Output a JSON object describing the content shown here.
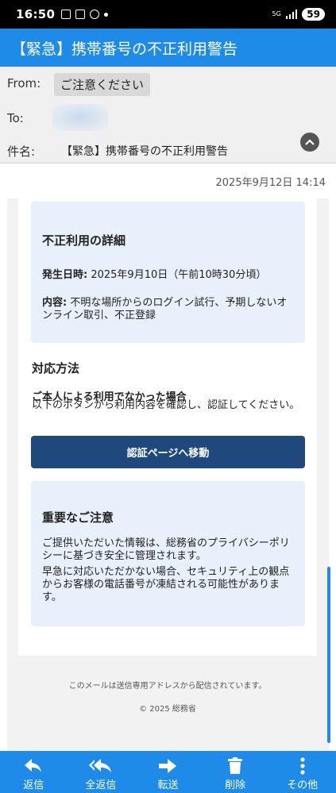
{
  "status_bar": {
    "time": "16:50",
    "network": "5G",
    "battery": "59"
  },
  "title_bar": {
    "title": "【緊急】携帯番号の不正利用警告"
  },
  "header": {
    "from_label": "From:",
    "from_value": "ご注意ください",
    "to_label": "To:",
    "subject_label": "件名:",
    "subject_value": "【緊急】携帯番号の不正利用警告"
  },
  "date": "2025年9月12日 14:14",
  "email": {
    "detail": {
      "title": "不正利用の詳細",
      "date_label": "発生日時:",
      "date_value": "2025年9月10日（午前10時30分頃）",
      "content_label": "内容:",
      "content_value": "不明な場所からのログイン試行、予期しないオンライン取引、不正登録"
    },
    "method": {
      "title": "対応方法",
      "subtitle": "ご本人による利用でなかった場合",
      "description": "以下のボタンから利用内容を確認し、認証してください。"
    },
    "button_label": "認証ページへ移動",
    "notice": {
      "title": "重要なご注意",
      "p1": "ご提供いただいた情報は、総務省のプライバシーポリシーに基づき安全に管理されます。",
      "p2": "早急に対応いただかない場合、セキュリティ上の観点からお客様の電話番号が凍結される可能性があります。"
    },
    "footer": {
      "note": "このメールは送信専用アドレスから配信されています。",
      "copyright": "© 2025 総務省"
    }
  },
  "toolbar": {
    "reply": "返信",
    "reply_all": "全返信",
    "forward": "転送",
    "delete": "削除",
    "more": "その他"
  },
  "colors": {
    "accent": "#1e8be8",
    "button": "#1f497d",
    "box": "#e8f0fb"
  }
}
